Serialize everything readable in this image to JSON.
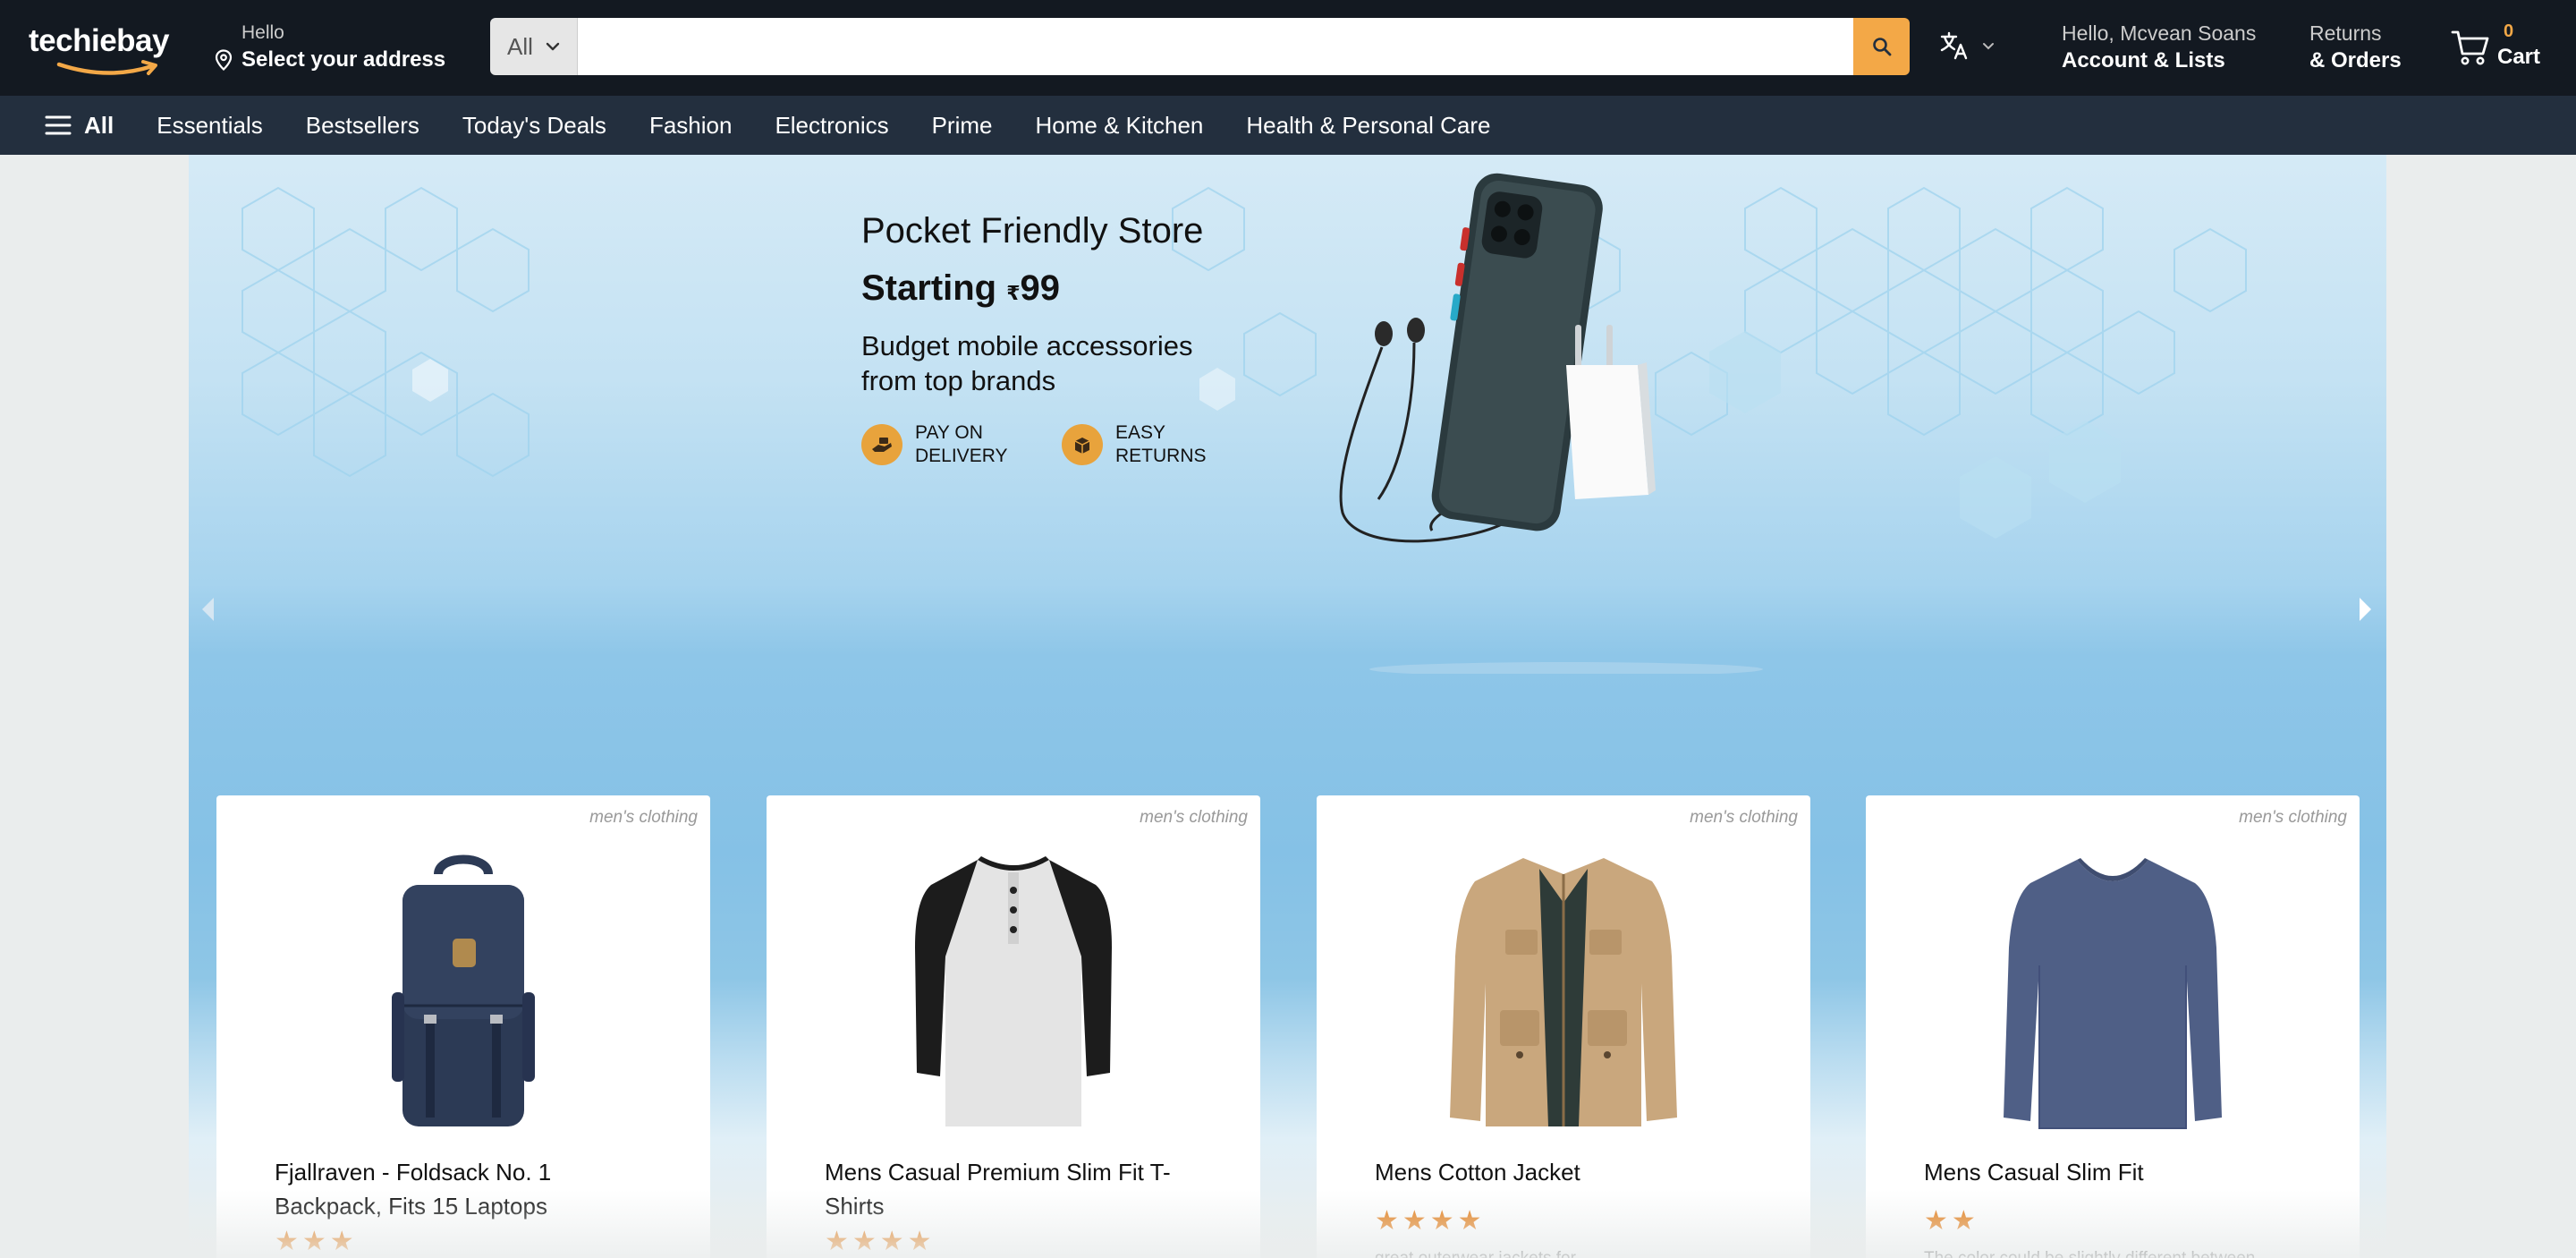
{
  "header": {
    "logo_text": "techiebay",
    "address_hello": "Hello",
    "address_main": "Select your address",
    "search_category": "All",
    "search_placeholder": "",
    "account_hello": "Hello, Mcvean Soans",
    "account_main": "Account & Lists",
    "returns_top": "Returns",
    "returns_main": "& Orders",
    "cart_count": "0",
    "cart_label": "Cart"
  },
  "nav": {
    "all_label": "All",
    "items": [
      "Essentials",
      "Bestsellers",
      "Today's Deals",
      "Fashion",
      "Electronics",
      "Prime",
      "Home & Kitchen",
      "Health & Personal Care"
    ]
  },
  "hero": {
    "title": "Pocket Friendly Store",
    "price_prefix": "Starting ",
    "currency": "₹",
    "price": "99",
    "subtitle": "Budget mobile accessories from top brands",
    "badge1": "PAY ON DELIVERY",
    "badge2": "EASY RETURNS"
  },
  "products": [
    {
      "category": "men's clothing",
      "title": "Fjallraven - Foldsack No. 1 Backpack, Fits 15 Laptops",
      "stars": "★★★",
      "rating": 3,
      "description": ""
    },
    {
      "category": "men's clothing",
      "title": "Mens Casual Premium Slim Fit T-Shirts",
      "stars": "★★★★",
      "rating": 4,
      "description": ""
    },
    {
      "category": "men's clothing",
      "title": "Mens Cotton Jacket",
      "stars": "★★★★",
      "rating": 4,
      "description": "great outerwear jackets for"
    },
    {
      "category": "men's clothing",
      "title": "Mens Casual Slim Fit",
      "stars": "★★",
      "rating": 2,
      "description": "The color could be slightly different between"
    }
  ],
  "colors": {
    "header_bg": "#131921",
    "nav_bg": "#232f3e",
    "accent": "#f3a847",
    "star": "#e47911"
  }
}
